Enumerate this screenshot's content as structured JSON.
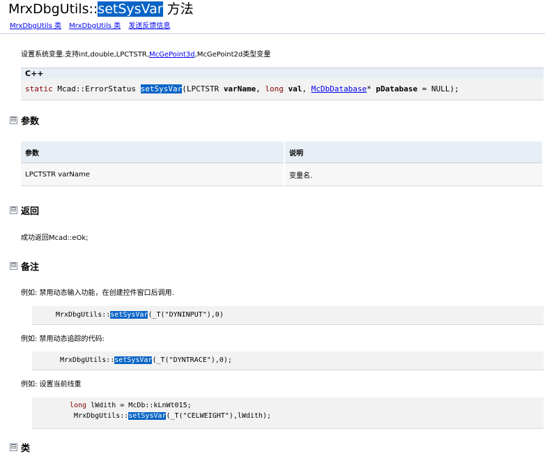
{
  "header": {
    "title_prefix": "MrxDbgUtils::",
    "title_highlight": "setSysVar",
    "title_suffix": " 方法",
    "links": [
      "MrxDbgUtils 类",
      "MrxDbgUtils 类",
      "发送反馈信息"
    ]
  },
  "description": {
    "text_before": "设置系统变量.支持int,double,LPCTSTR,",
    "link": "McGePoint3d",
    "text_after": ",McGePoint2d类型变量"
  },
  "signature": {
    "lang": "C++",
    "kw_static": "static",
    "ret": " Mcad::ErrorStatus ",
    "fn": "setSysVar",
    "args_before": "(LPCTSTR ",
    "arg1": "varName",
    "sep1": ", ",
    "kw_long": "long",
    "sp": " ",
    "arg2": "val",
    "sep2": ", ",
    "db_link": "McDbDatabase",
    "star": "* ",
    "arg3": "pDatabase",
    "args_after": " = NULL);"
  },
  "sections": {
    "params": "参数",
    "returns": "返回",
    "remarks": "备注",
    "class": "类"
  },
  "params_table": {
    "headers": [
      "参数",
      "说明"
    ],
    "rows": [
      [
        "LPCTSTR varName",
        "变量名."
      ]
    ]
  },
  "returns_text": "成功返回Mcad::eOk;",
  "remarks": {
    "ex1_label": "例如: 禁用动态输入功能，在创建控件窗口后调用.",
    "ex1_pre": "MrxDbgUtils::",
    "ex1_fn": "setSysVar",
    "ex1_post": "(_T(\"DYNINPUT\"),0)",
    "ex2_label": "例如: 禁用动态追踪的代码:",
    "ex2_pre": "MrxDbgUtils::",
    "ex2_fn": "setSysVar",
    "ex2_post": "(_T(\"DYNTRACE\"),0);",
    "ex3_label": "例如: 设置当前线重",
    "ex3_kw": "long",
    "ex3_line1": " lWdith = McDb::kLnWt015;",
    "ex3_pre": "MrxDbgUtils::",
    "ex3_fn": "setSysVar",
    "ex3_post": "(_T(\"CELWEIGHT\"),lWdith);"
  },
  "toggle_symbol": "⊟"
}
